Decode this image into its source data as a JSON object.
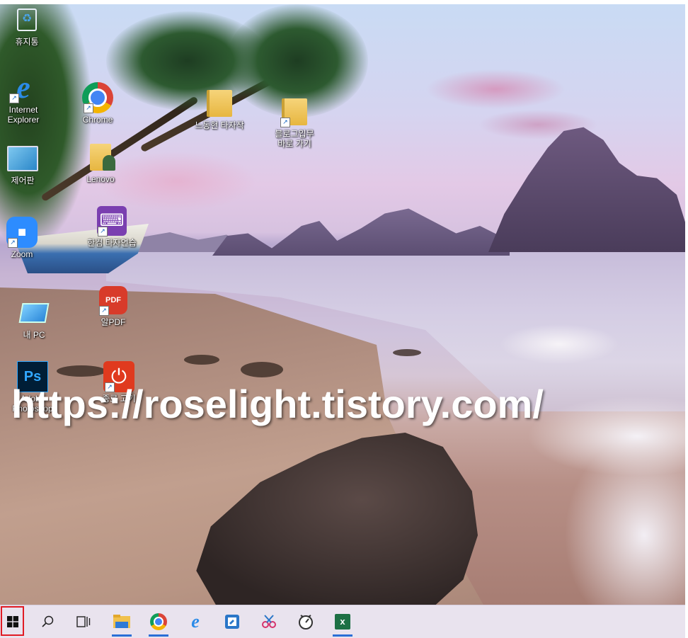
{
  "desktop": {
    "icons": [
      {
        "id": "recycle",
        "label": "휴지통",
        "glyph": "♻"
      },
      {
        "id": "ie",
        "label": "Internet Explorer",
        "glyph": "e"
      },
      {
        "id": "chrome",
        "label": "Chrome",
        "glyph": ""
      },
      {
        "id": "folder1",
        "label": "느동현 타자작",
        "glyph": ""
      },
      {
        "id": "folder2",
        "label": "블로그입무 바로 가기",
        "glyph": ""
      },
      {
        "id": "control",
        "label": "제어판",
        "glyph": ""
      },
      {
        "id": "lenovo",
        "label": "Lenovo",
        "glyph": ""
      },
      {
        "id": "zoom",
        "label": "Zoom",
        "glyph": "■"
      },
      {
        "id": "hancom",
        "label": "한컴 타자연습",
        "glyph": "⌨"
      },
      {
        "id": "mypc",
        "label": "내 PC",
        "glyph": ""
      },
      {
        "id": "alpdf",
        "label": "알PDF",
        "glyph": "PDF"
      },
      {
        "id": "photoshop",
        "label": "Adobe Photoshop",
        "glyph": "Ps"
      },
      {
        "id": "shutdown",
        "label": "종료 고기",
        "glyph": "⏻"
      }
    ],
    "shortcut_arrow": "↗"
  },
  "watermark": "https://roselight.tistory.com/",
  "taskbar": {
    "start_icon": "windows-logo",
    "search_glyph": "⚲",
    "taskview_glyph": "⧉",
    "apps": [
      "file-explorer",
      "chrome",
      "internet-explorer",
      "sticky-notes",
      "snipping-tool",
      "alarms-clock",
      "excel"
    ],
    "excel_letter": "x",
    "colors": {
      "start_highlight": "#e01b24",
      "active_indicator": "#2a6fd6"
    }
  }
}
